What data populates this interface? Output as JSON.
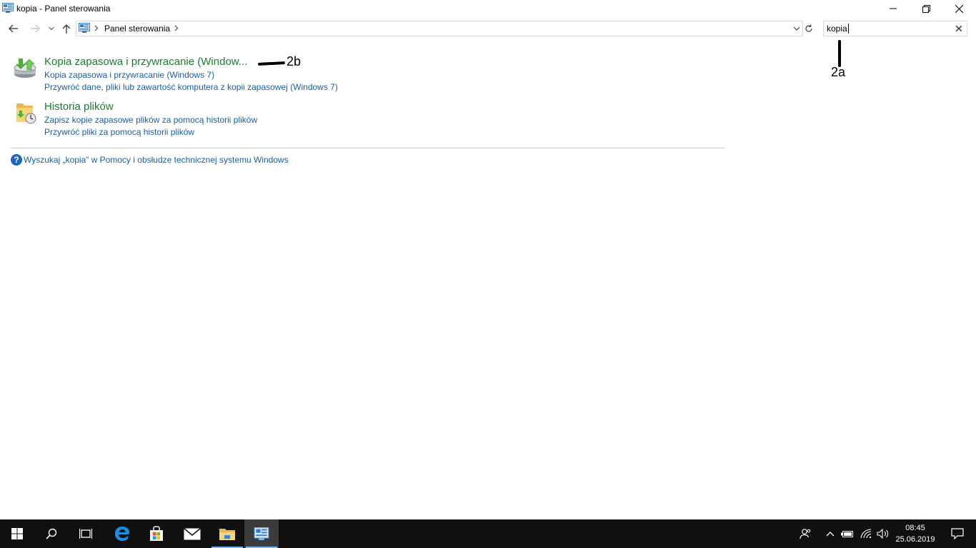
{
  "window": {
    "title": "kopia - Panel sterowania"
  },
  "navbar": {
    "breadcrumb": "Panel sterowania",
    "search_value": "kopia"
  },
  "results": [
    {
      "title": "Kopia zapasowa i przywracanie (Window...",
      "icon": "backup-restore-icon",
      "links": [
        "Kopia zapasowa i przywracanie (Windows 7)",
        "Przywróć dane, pliki lub zawartość komputera z kopii zapasowej (Windows 7)"
      ]
    },
    {
      "title": "Historia plików",
      "icon": "file-history-icon",
      "links": [
        "Zapisz kopie zapasowe plików za pomocą historii plików",
        "Przywróć pliki za pomocą historii plików"
      ]
    }
  ],
  "help": {
    "text": "Wyszukaj „kopia” w Pomocy i obsłudze technicznej systemu Windows"
  },
  "annotations": {
    "label_2a": "2a",
    "label_2b": "2b"
  },
  "taskbar": {
    "time": "08:45",
    "date": "25.06.2019"
  },
  "colors": {
    "title_green": "#1e7a34",
    "link_blue": "#1a5ea8",
    "taskbar_bg": "#101010"
  }
}
